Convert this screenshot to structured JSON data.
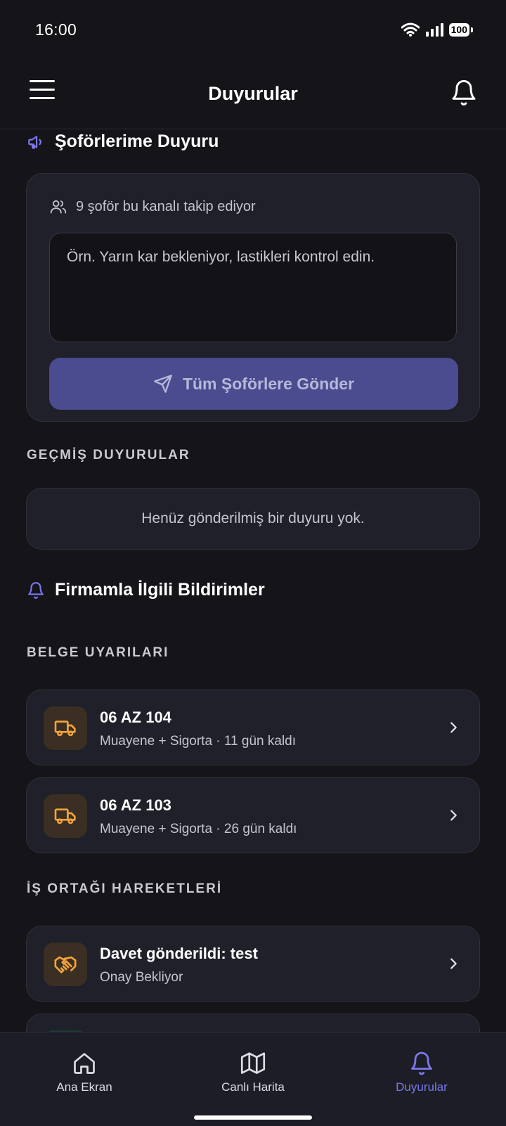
{
  "status_bar": {
    "time": "16:00",
    "battery": "100"
  },
  "header": {
    "title": "Duyurular"
  },
  "announce_section": {
    "title": "Şoförlerime Duyuru",
    "follower_text": "9 şoför bu kanalı takip ediyor",
    "message_placeholder": "Örn. Yarın kar bekleniyor, lastikleri kontrol edin.",
    "send_label": "Tüm Şoförlere Gönder"
  },
  "history": {
    "label": "GEÇMİŞ DUYURULAR",
    "empty_text": "Henüz gönderilmiş bir duyuru yok."
  },
  "company_section": {
    "title": "Firmamla İlgili Bildirimler"
  },
  "document_alerts": {
    "label": "BELGE UYARILARI",
    "items": [
      {
        "title": "06 AZ 104",
        "subtitle": "Muayene + Sigorta · 11 gün kaldı",
        "icon": "truck-icon"
      },
      {
        "title": "06 AZ 103",
        "subtitle": "Muayene + Sigorta · 26 gün kaldı",
        "icon": "truck-icon"
      }
    ]
  },
  "partner_activity": {
    "label": "İŞ ORTAĞI HAREKETLERİ",
    "items": [
      {
        "title": "Davet gönderildi: test",
        "subtitle": "Onay Bekliyor",
        "icon": "handshake-icon"
      }
    ]
  },
  "bottom_nav": {
    "items": [
      {
        "label": "Ana Ekran",
        "icon": "home-icon"
      },
      {
        "label": "Canlı Harita",
        "icon": "map-icon"
      },
      {
        "label": "Duyurular",
        "icon": "bell-icon",
        "active": true
      }
    ]
  },
  "colors": {
    "background": "#141419",
    "card": "#1f2029",
    "accent": "#7b78ea",
    "send_button": "#4a4c8f",
    "warning_icon": "#f2a33a"
  }
}
